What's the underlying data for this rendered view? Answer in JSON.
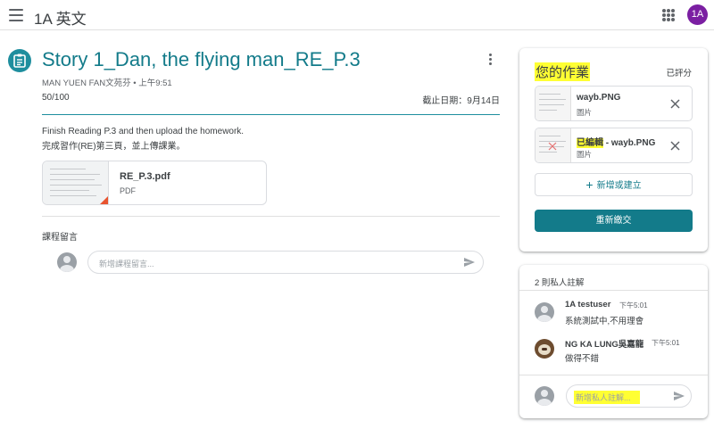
{
  "topbar": {
    "class_name": "1A 英文",
    "account_initials": "1A",
    "account_color": "#7b1fa2"
  },
  "assignment": {
    "title": "Story 1_Dan, the flying man_RE_P.3",
    "author_line": "MAN YUEN FAN文苑芬 • 上午9:51",
    "points": "50/100",
    "due": "截止日期：9月14日",
    "description_line1": "Finish Reading P.3 and then upload the homework.",
    "description_line2": "完成習作(RE)第三頁，並上傳課業。",
    "attachment": {
      "name": "RE_P.3.pdf",
      "type": "PDF"
    },
    "comments_label": "課程留言",
    "comment_placeholder": "新增課程留言..."
  },
  "your_work": {
    "title": "您的作業",
    "status": "已評分",
    "files": [
      {
        "prefix": "",
        "name": "wayb.PNG",
        "type": "圖片"
      },
      {
        "prefix": "已編輯",
        "name": " - wayb.PNG",
        "type": "圖片"
      }
    ],
    "add_label": "新增或建立",
    "resubmit_label": "重新繳交"
  },
  "private_comments": {
    "header": "2 則私人註解",
    "comments": [
      {
        "name": "1A testuser",
        "time": "下午5:01",
        "text": "系統測試中,不用理會"
      },
      {
        "name": "NG KA LUNG吳嘉龍",
        "time": "下午5:01",
        "text": "做得不錯"
      }
    ],
    "placeholder": "新增私人註解..."
  },
  "colors": {
    "accent": "#137b8a",
    "highlight": "#ffff33",
    "pdf_corner": "#e8542f"
  }
}
